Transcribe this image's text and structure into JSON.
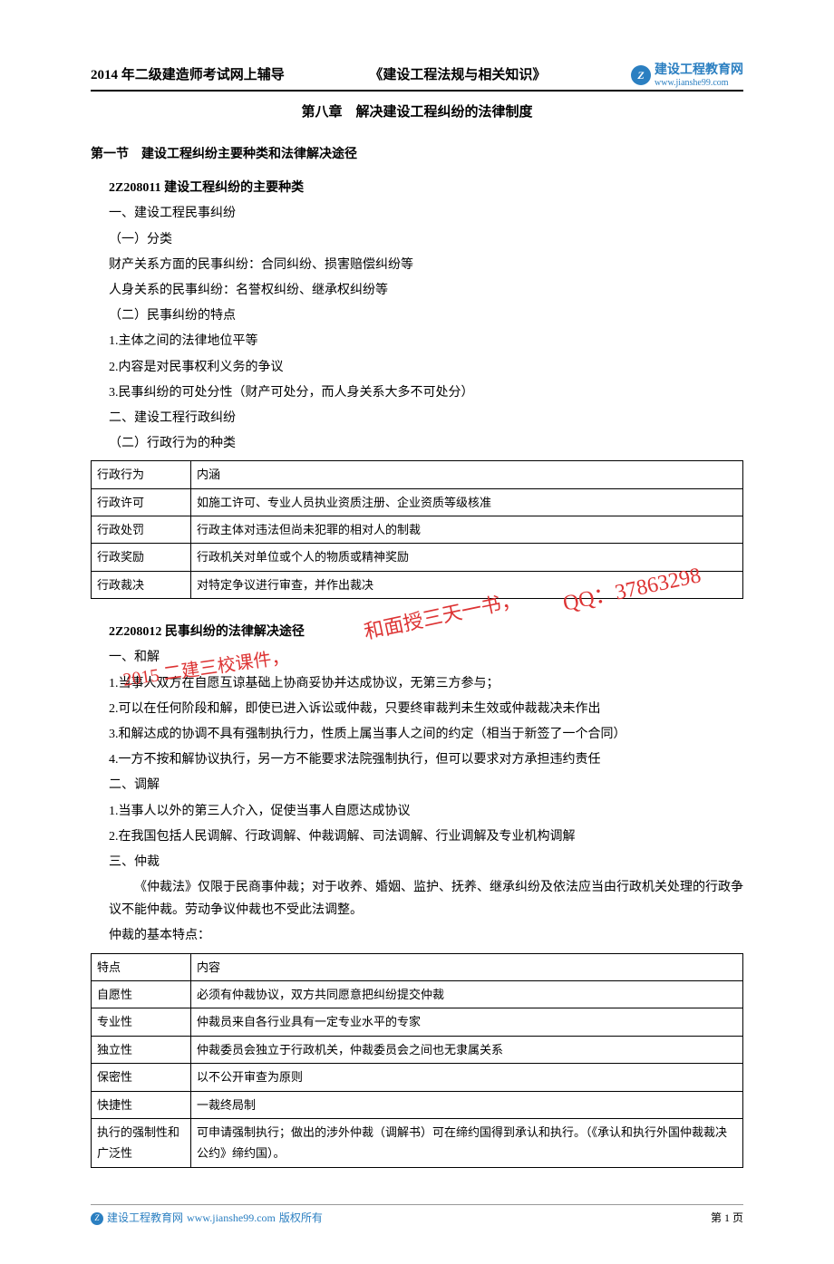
{
  "header": {
    "left": "2014 年二级建造师考试网上辅导",
    "center": "《建设工程法规与相关知识》",
    "logo_letter": "Z",
    "logo_main": "建设工程教育网",
    "logo_url": "www.jianshe99.com"
  },
  "chapter_title": "第八章　解决建设工程纠纷的法律制度",
  "section1": {
    "title": "第一节　建设工程纠纷主要种类和法律解决途径",
    "sub1_code": "2Z208011 建设工程纠纷的主要种类",
    "p1": "一、建设工程民事纠纷",
    "p2": "（一）分类",
    "p3": "财产关系方面的民事纠纷：合同纠纷、损害赔偿纠纷等",
    "p4": "人身关系的民事纠纷：名誉权纠纷、继承权纠纷等",
    "p5": "（二）民事纠纷的特点",
    "p6": "1.主体之间的法律地位平等",
    "p7": "2.内容是对民事权利义务的争议",
    "p8": "3.民事纠纷的可处分性（财产可处分，而人身关系大多不可处分）",
    "p9": "二、建设工程行政纠纷",
    "p10": "（二）行政行为的种类"
  },
  "table1": {
    "h1": "行政行为",
    "h2": "内涵",
    "r1c1": "行政许可",
    "r1c2": "如施工许可、专业人员执业资质注册、企业资质等级核准",
    "r2c1": "行政处罚",
    "r2c2": "行政主体对违法但尚未犯罪的相对人的制裁",
    "r3c1": "行政奖励",
    "r3c2": "行政机关对单位或个人的物质或精神奖励",
    "r4c1": "行政裁决",
    "r4c2": "对特定争议进行审查，并作出裁决"
  },
  "section2": {
    "sub_code": "2Z208012 民事纠纷的法律解决途径",
    "p1": "一、和解",
    "p2": "1.当事人双方在自愿互谅基础上协商妥协并达成协议，无第三方参与；",
    "p3": "2.可以在任何阶段和解，即使已进入诉讼或仲裁，只要终审裁判未生效或仲裁裁决未作出",
    "p4": "3.和解达成的协调不具有强制执行力，性质上属当事人之间的约定（相当于新签了一个合同）",
    "p5": "4.一方不按和解协议执行，另一方不能要求法院强制执行，但可以要求对方承担违约责任",
    "p6": "二、调解",
    "p7": "1.当事人以外的第三人介入，促使当事人自愿达成协议",
    "p8": "2.在我国包括人民调解、行政调解、仲裁调解、司法调解、行业调解及专业机构调解",
    "p9": "三、仲裁",
    "p10": "《仲裁法》仅限于民商事仲裁；对于收养、婚姻、监护、抚养、继承纠纷及依法应当由行政机关处理的行政争议不能仲裁。劳动争议仲裁也不受此法调整。",
    "p11": "仲裁的基本特点："
  },
  "table2": {
    "h1": "特点",
    "h2": "内容",
    "r1c1": "自愿性",
    "r1c2": "必须有仲裁协议，双方共同愿意把纠纷提交仲裁",
    "r2c1": "专业性",
    "r2c2": "仲裁员来自各行业具有一定专业水平的专家",
    "r3c1": "独立性",
    "r3c2": "仲裁委员会独立于行政机关，仲裁委员会之间也无隶属关系",
    "r4c1": "保密性",
    "r4c2": "以不公开审查为原则",
    "r5c1": "快捷性",
    "r5c2": "一裁终局制",
    "r6c1": "执行的强制性和广泛性",
    "r6c2": "可申请强制执行；做出的涉外仲裁（调解书）可在缔约国得到承认和执行。（《承认和执行外国仲裁裁决公约》缔约国）。"
  },
  "watermark": {
    "text1": "和面授三天一书，",
    "text2": "QQ：37863298",
    "text3": "2015 二建三校课件，"
  },
  "footer": {
    "brand": "建设工程教育网",
    "url": "www.jianshe99.com",
    "copyright": "版权所有",
    "page": "第 1 页"
  }
}
